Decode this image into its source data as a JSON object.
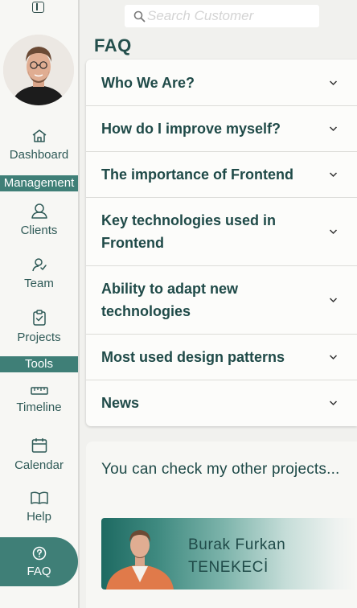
{
  "search": {
    "placeholder": "Search Customer",
    "value": ""
  },
  "sidebar": {
    "items": [
      {
        "label": "Dashboard",
        "icon": "home-icon"
      },
      {
        "label": "Clients",
        "icon": "user-icon"
      },
      {
        "label": "Team",
        "icon": "team-icon"
      },
      {
        "label": "Projects",
        "icon": "clipboard-check-icon"
      },
      {
        "label": "Timeline",
        "icon": "ruler-icon"
      },
      {
        "label": "Calendar",
        "icon": "calendar-icon"
      },
      {
        "label": "Help",
        "icon": "book-icon"
      },
      {
        "label": "FAQ",
        "icon": "question-circle-icon",
        "active": true
      }
    ],
    "sections": [
      "Management",
      "Tools"
    ]
  },
  "main": {
    "title": "FAQ",
    "faq": [
      "Who We Are?",
      "How do I improve myself?",
      "The importance of Frontend",
      "Key technologies used in Frontend",
      "Ability to adapt new technologies",
      "Most used design patterns",
      "News"
    ],
    "projects": {
      "text": "You can check my other projects...",
      "name_line1": "Burak Furkan",
      "name_line2": "TENEKECİ"
    }
  },
  "colors": {
    "accent": "#3f7f77",
    "text": "#1f4a48",
    "background": "#f1f1ee"
  }
}
